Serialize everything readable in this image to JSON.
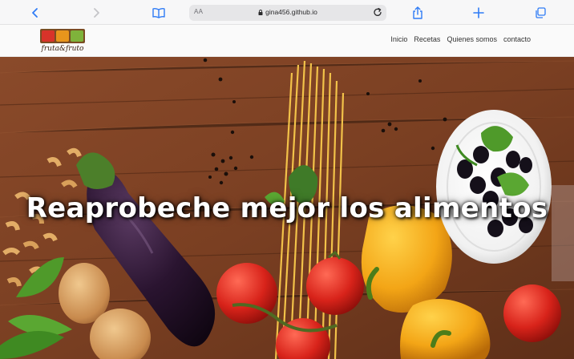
{
  "browser": {
    "url_prefix": "AA",
    "url": "gina456.github.io",
    "icons": [
      "back-icon",
      "forward-icon",
      "book-icon",
      "lock-icon",
      "reload-icon",
      "share-icon",
      "plus-icon",
      "tabs-icon"
    ],
    "accent": "#2f7cf6"
  },
  "site": {
    "logo_text": "fruta&fruto",
    "nav": [
      "Inicio",
      "Recetas",
      "Quienes somos",
      "contacto"
    ]
  },
  "hero": {
    "title": "Reaprobeche mejor los alimentos"
  }
}
